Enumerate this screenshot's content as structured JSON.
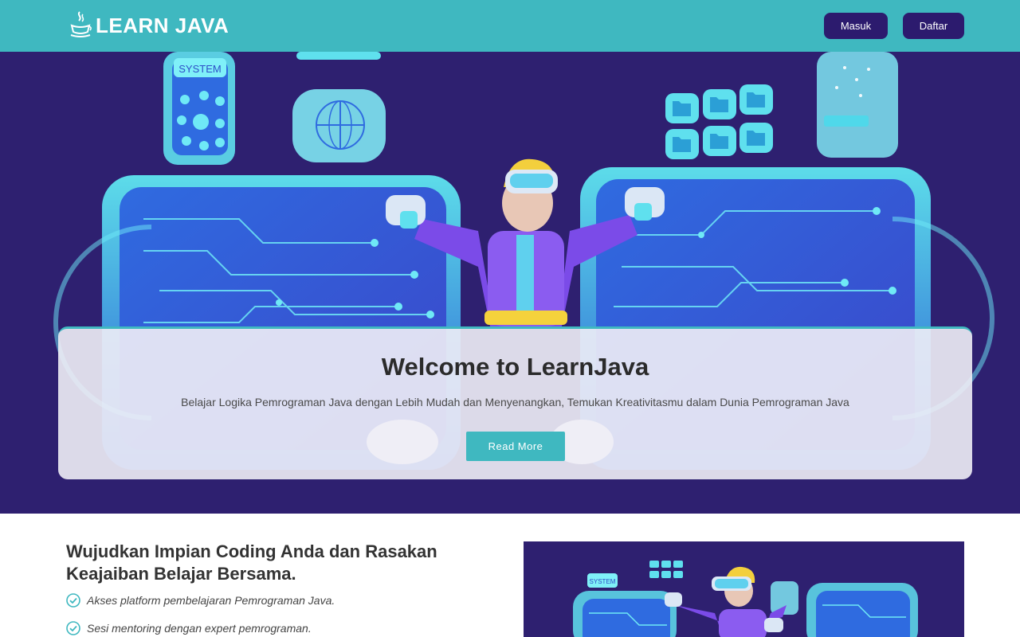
{
  "header": {
    "logo_text": "LEARN JAVA",
    "login_label": "Masuk",
    "register_label": "Daftar"
  },
  "hero": {
    "title": "Welcome to LearnJava",
    "subtitle": "Belajar Logika Pemrograman Java dengan Lebih Mudah dan Menyenangkan, Temukan Kreativitasmu dalam Dunia Pemrograman Java",
    "cta_label": "Read More",
    "art_panel_label": "SYSTEM"
  },
  "feature": {
    "heading_line1": "Wujudkan Impian Coding Anda dan Rasakan",
    "heading_line2": "Keajaiban Belajar Bersama.",
    "items": [
      "Akses platform pembelajaran Pemrograman Java.",
      "Sesi mentoring dengan expert pemrograman."
    ],
    "image_label": "SYSTEM"
  },
  "colors": {
    "accent": "#3fb8c0",
    "navy": "#2c1b6e",
    "hero_bg": "#2e2070"
  },
  "icons": [
    "java-cup-icon",
    "check-circle-icon",
    "folder-icon",
    "globe-icon",
    "fingerprint-icon"
  ]
}
